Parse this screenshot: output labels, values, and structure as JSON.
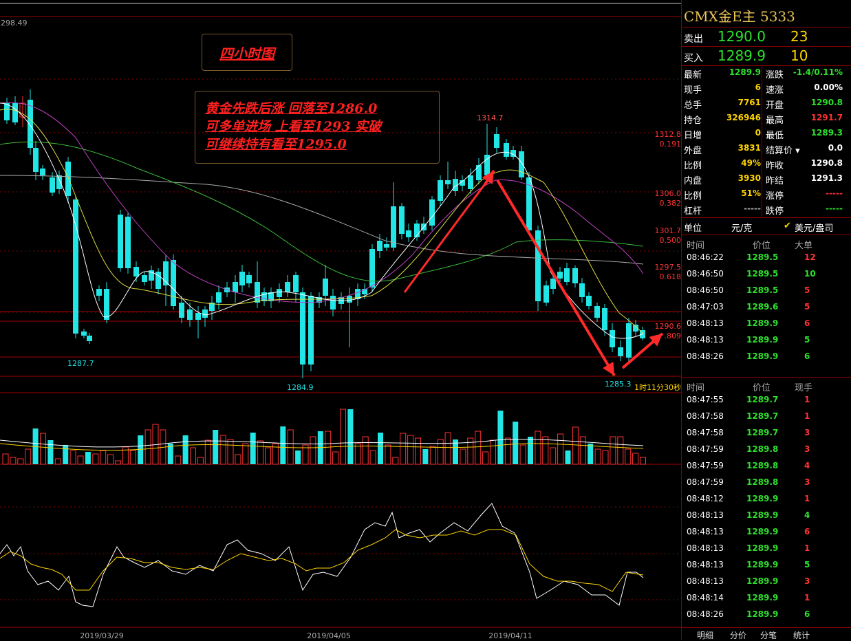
{
  "chart": {
    "y_top_label": "298.49",
    "price_labels": [
      {
        "text": "1314.7"
      },
      {
        "text": "1287.7"
      },
      {
        "text": "1284.9"
      },
      {
        "text": "1285.3"
      }
    ],
    "fib_labels": [
      {
        "price": "1312.8",
        "ratio": "0.191"
      },
      {
        "price": "1306.0",
        "ratio": "0.382"
      },
      {
        "price": "1301.7",
        "ratio": "0.500"
      },
      {
        "price": "1297.5",
        "ratio": "0.618"
      },
      {
        "price": "1290.6",
        "ratio": ".809"
      }
    ],
    "countdown": "1时11分30秒",
    "dates": [
      "2019/03/29",
      "2019/04/05",
      "2019/04/11"
    ],
    "colors": {
      "up": "#ff3333",
      "down": "#22e5e5",
      "grid": "#a00000"
    }
  },
  "annotations": {
    "title": "四小时图",
    "lines": [
      "黄金先跌后涨 回落至1286.0",
      "可多单进场 上看至1293 实破",
      "可继续持有看至1295.0"
    ]
  },
  "panel": {
    "title": "CMX金E主  5333",
    "sell": {
      "label": "卖出",
      "price": "1290.0",
      "vol": "23"
    },
    "buy": {
      "label": "买入",
      "price": "1289.9",
      "vol": "10"
    },
    "stats_left": [
      {
        "k": "最新",
        "v": "1289.9",
        "c": "#2ee02e"
      },
      {
        "k": "现手",
        "v": "6",
        "c": "#ffd400"
      },
      {
        "k": "总手",
        "v": "7761",
        "c": "#ffd400"
      },
      {
        "k": "持仓",
        "v": "326946",
        "c": "#ffd400"
      },
      {
        "k": "日增",
        "v": "0",
        "c": "#ffd400"
      },
      {
        "k": "外盘",
        "v": "3831",
        "c": "#ffd400"
      },
      {
        "k": "比例",
        "v": "49%",
        "c": "#ffd400"
      },
      {
        "k": "内盘",
        "v": "3930",
        "c": "#ffd400"
      },
      {
        "k": "比例",
        "v": "51%",
        "c": "#ffd400"
      },
      {
        "k": "杠杆",
        "v": "-----",
        "c": "#aaa"
      }
    ],
    "stats_right": [
      {
        "k": "涨跌",
        "v": "-1.4/0.11%",
        "c": "#2ee02e"
      },
      {
        "k": "速涨",
        "v": "0.00%",
        "c": "#fff"
      },
      {
        "k": "开盘",
        "v": "1290.8",
        "c": "#2ee02e"
      },
      {
        "k": "最高",
        "v": "1291.7",
        "c": "#ff3333"
      },
      {
        "k": "最低",
        "v": "1289.3",
        "c": "#2ee02e"
      },
      {
        "k": "结算价",
        "v": "0.0",
        "c": "#fff"
      },
      {
        "k": "昨收",
        "v": "1290.8",
        "c": "#fff"
      },
      {
        "k": "昨结",
        "v": "1291.3",
        "c": "#fff"
      },
      {
        "k": "涨停",
        "v": "-----",
        "c": "#ff3333"
      },
      {
        "k": "跌停",
        "v": "-----",
        "c": "#2ee02e"
      }
    ],
    "unit": {
      "label": "单位",
      "cny": "元/克",
      "usd": "美元/盎司"
    },
    "big_head": {
      "time": "时间",
      "price": "价位",
      "vol": "大单"
    },
    "big_orders": [
      {
        "t": "08:46:22",
        "p": "1289.5",
        "n": "12",
        "c": "#ff3333"
      },
      {
        "t": "08:46:50",
        "p": "1289.5",
        "n": "10",
        "c": "#2ee02e"
      },
      {
        "t": "08:46:50",
        "p": "1289.5",
        "n": "5",
        "c": "#ff3333"
      },
      {
        "t": "08:47:03",
        "p": "1289.6",
        "n": "5",
        "c": "#ff3333"
      },
      {
        "t": "08:48:13",
        "p": "1289.9",
        "n": "6",
        "c": "#ff3333"
      },
      {
        "t": "08:48:13",
        "p": "1289.9",
        "n": "5",
        "c": "#2ee02e"
      },
      {
        "t": "08:48:26",
        "p": "1289.9",
        "n": "6",
        "c": "#2ee02e"
      }
    ],
    "tick_head": {
      "time": "时间",
      "price": "价位",
      "vol": "现手"
    },
    "ticks": [
      {
        "t": "08:47:55",
        "p": "1289.7",
        "n": "1",
        "c": "#ff3333"
      },
      {
        "t": "08:47:58",
        "p": "1289.7",
        "n": "1",
        "c": "#ff3333"
      },
      {
        "t": "08:47:58",
        "p": "1289.7",
        "n": "3",
        "c": "#ff3333"
      },
      {
        "t": "08:47:59",
        "p": "1289.8",
        "n": "3",
        "c": "#ff3333"
      },
      {
        "t": "08:47:59",
        "p": "1289.8",
        "n": "4",
        "c": "#ff3333"
      },
      {
        "t": "08:47:59",
        "p": "1289.8",
        "n": "3",
        "c": "#ff3333"
      },
      {
        "t": "08:48:12",
        "p": "1289.9",
        "n": "1",
        "c": "#ff3333"
      },
      {
        "t": "08:48:13",
        "p": "1289.9",
        "n": "4",
        "c": "#2ee02e"
      },
      {
        "t": "08:48:13",
        "p": "1289.9",
        "n": "6",
        "c": "#ff3333"
      },
      {
        "t": "08:48:13",
        "p": "1289.9",
        "n": "1",
        "c": "#ff3333"
      },
      {
        "t": "08:48:13",
        "p": "1289.9",
        "n": "5",
        "c": "#2ee02e"
      },
      {
        "t": "08:48:13",
        "p": "1289.9",
        "n": "3",
        "c": "#ff3333"
      },
      {
        "t": "08:48:14",
        "p": "1289.9",
        "n": "1",
        "c": "#ff3333"
      },
      {
        "t": "08:48:26",
        "p": "1289.9",
        "n": "6",
        "c": "#2ee02e"
      }
    ],
    "tabs": [
      "明细",
      "分价",
      "分笔",
      "统计"
    ]
  }
}
